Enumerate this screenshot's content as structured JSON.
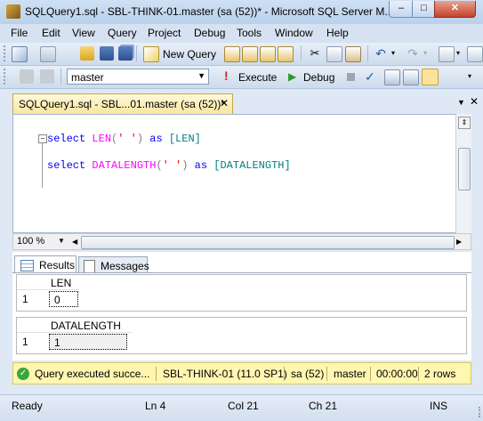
{
  "window": {
    "title": "SQLQuery1.sql - SBL-THINK-01.master (sa (52))* - Microsoft SQL Server M...",
    "min": "–",
    "max": "□",
    "close": "✕"
  },
  "menu": [
    "File",
    "Edit",
    "View",
    "Query",
    "Project",
    "Debug",
    "Tools",
    "Window",
    "Help"
  ],
  "toolbar": {
    "new_query": "New Query",
    "database": "master",
    "execute": "Execute",
    "debug": "Debug",
    "icons": [
      "new-file-icon",
      "open-icon",
      "save-icon",
      "save-all-icon",
      "new-query-icon",
      "db-engine-query-icon",
      "analysis-query-icon",
      "mdx-icon",
      "xmla-icon",
      "cut-icon",
      "copy-icon",
      "paste-icon",
      "undo-icon",
      "redo-icon",
      "execute-icon",
      "debug-icon",
      "stop-icon",
      "parse-icon",
      "results-icon"
    ]
  },
  "tab": {
    "label": "SQLQuery1.sql - SBL...01.master (sa (52))*",
    "close": "✕"
  },
  "editor": {
    "line1": {
      "kw1": "select",
      "fn": "LEN",
      "p1": "(",
      "str": "' '",
      "p2": ")",
      "kw2": "as",
      "alias": "[LEN]"
    },
    "line2": {
      "kw1": "select",
      "fn": "DATALENGTH",
      "p1": "(",
      "str": "' '",
      "p2": ")",
      "kw2": "as",
      "alias": "[DATALENGTH]"
    }
  },
  "zoom": "100 %",
  "results": {
    "tabs": {
      "results": "Results",
      "messages": "Messages"
    },
    "grid1": {
      "column": "LEN",
      "row_number": "1",
      "value": "0"
    },
    "grid2": {
      "column": "DATALENGTH",
      "row_number": "1",
      "value": "1"
    }
  },
  "query_status": {
    "message": "Query executed succe...",
    "server": "SBL-THINK-01 (11.0 SP1)",
    "user": "sa (52)",
    "database": "master",
    "elapsed": "00:00:00",
    "rows": "2 rows"
  },
  "statusbar": {
    "ready": "Ready",
    "line": "Ln 4",
    "col": "Col 21",
    "ch": "Ch 21",
    "mode": "INS"
  },
  "colors": {
    "keyword": "#0000ff",
    "function": "#ff00ff",
    "string": "#ff0000",
    "identifier": "#008080",
    "status_bg": "#fff6b0"
  }
}
